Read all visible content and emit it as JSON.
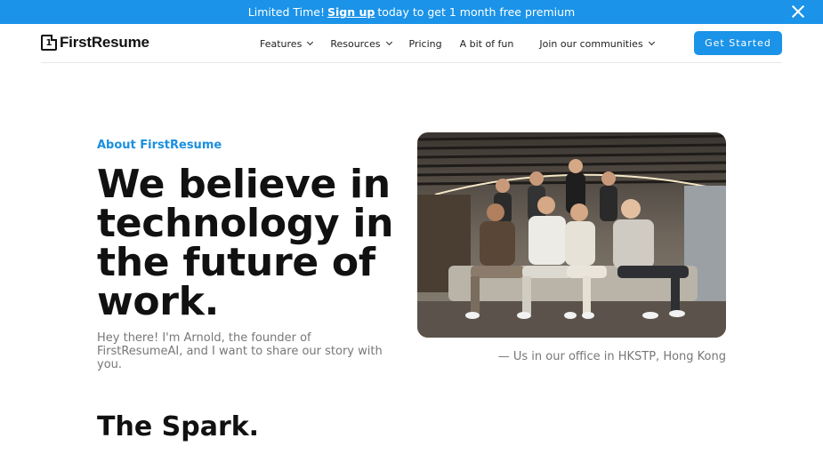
{
  "promo": {
    "prefix": "Limited Time!",
    "link": "Sign up",
    "suffix": "today to get 1 month free premium"
  },
  "nav": {
    "logo_mark": "1",
    "logo_text": "FirstResume",
    "items": [
      {
        "label": "Features",
        "dropdown": true
      },
      {
        "label": "Resources",
        "dropdown": true
      },
      {
        "label": "Pricing",
        "dropdown": false
      },
      {
        "label": "A bit of fun",
        "dropdown": false
      },
      {
        "label": "Join our communities",
        "dropdown": true
      }
    ],
    "cta": "Get Started"
  },
  "hero": {
    "eyebrow": "About FirstResume",
    "title": "We believe in technology in the future of work.",
    "subtitle": "Hey there! I'm Arnold, the founder of FirstResumeAI, and I want to share our story with you.",
    "photo_caption": "— Us in our office in HKSTP, Hong Kong"
  },
  "section": {
    "title": "The Spark."
  },
  "colors": {
    "accent": "#1a93e8",
    "heading": "#111111",
    "muted": "#777777"
  }
}
